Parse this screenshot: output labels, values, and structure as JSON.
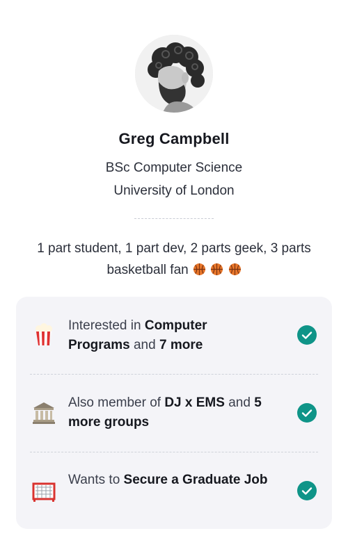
{
  "profile": {
    "name": "Greg Campbell",
    "degree": "BSc Computer Science",
    "university": "University of London",
    "bio": "1 part student, 1 part dev, 2 parts geek, 3 parts basketball fan",
    "bio_emoji": "basketball-icon",
    "bio_emoji_count": 3
  },
  "details": [
    {
      "icon": "popcorn-icon",
      "prefix": "Interested in ",
      "highlight": "Computer Programs",
      "middle": " and ",
      "highlight2": "7 more",
      "suffix": "",
      "status": "check-icon"
    },
    {
      "icon": "classical-building-icon",
      "prefix": "Also member of ",
      "highlight": "DJ x EMS",
      "middle": " and ",
      "highlight2": "5 more groups",
      "suffix": "",
      "status": "check-icon"
    },
    {
      "icon": "goal-net-icon",
      "prefix": "Wants to ",
      "highlight": "Secure a Graduate Job",
      "middle": "",
      "highlight2": "",
      "suffix": "",
      "status": "check-icon"
    }
  ],
  "colors": {
    "check": "#0f9488",
    "card_bg": "#f4f4f8",
    "text": "#1f2230"
  }
}
